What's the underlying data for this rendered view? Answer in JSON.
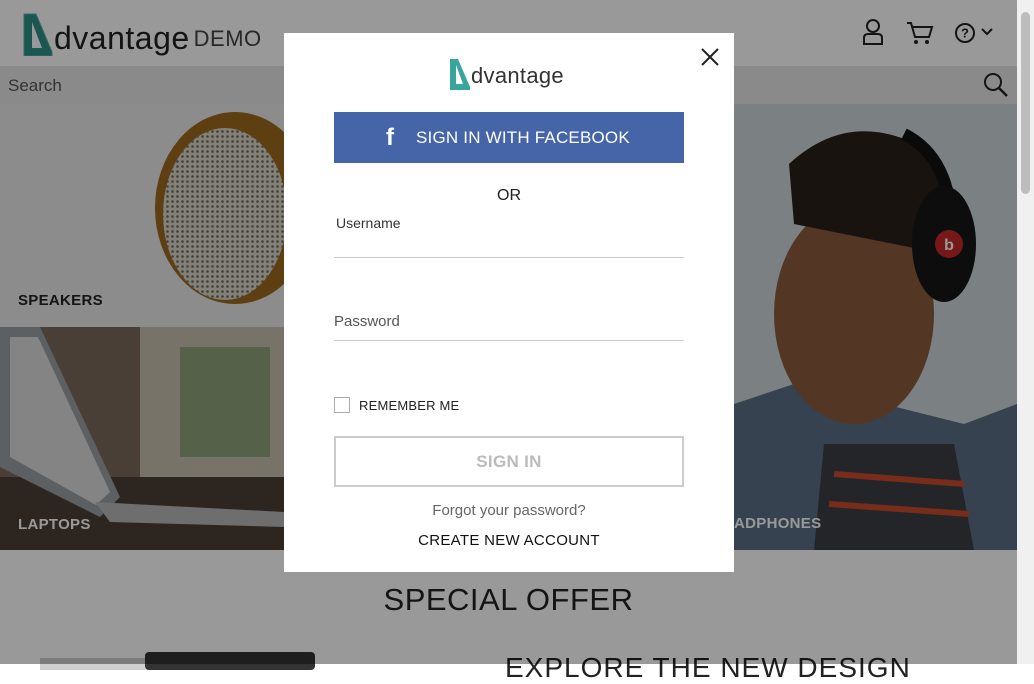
{
  "header": {
    "logo_text": "dvantage",
    "logo_suffix": "DEMO",
    "icons": [
      "user-icon",
      "cart-icon",
      "help-icon",
      "chevron-down-icon"
    ]
  },
  "search": {
    "placeholder": "Search"
  },
  "categories": {
    "speakers": "SPEAKERS",
    "laptops": "LAPTOPS",
    "headphones": "ADPHONES"
  },
  "special": {
    "title": "SPECIAL OFFER",
    "subtitle": "EXPLORE THE NEW DESIGN"
  },
  "modal": {
    "logo_text": "dvantage",
    "facebook_label": "SIGN IN WITH FACEBOOK",
    "or_label": "OR",
    "username_label": "Username",
    "password_label": "Password",
    "remember_label": "REMEMBER ME",
    "signin_label": "SIGN IN",
    "forgot_label": "Forgot your password?",
    "create_label": "CREATE NEW ACCOUNT"
  },
  "colors": {
    "brand_teal": "#3aa59a",
    "facebook": "#4565a8"
  }
}
